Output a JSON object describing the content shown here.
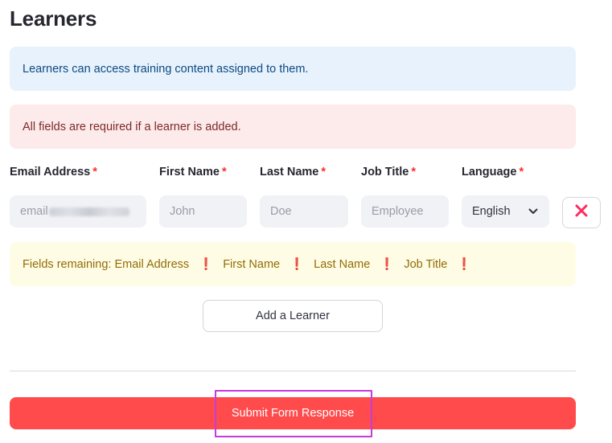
{
  "page": {
    "title": "Learners"
  },
  "alerts": {
    "info": "Learners can access training content assigned to them.",
    "error": "All fields are required if a learner is added."
  },
  "columns": {
    "email": "Email Address",
    "first_name": "First Name",
    "last_name": "Last Name",
    "job_title": "Job Title",
    "language": "Language",
    "required_marker": "*"
  },
  "row": {
    "email_value": "email",
    "first_name_placeholder": "John",
    "last_name_placeholder": "Doe",
    "job_title_placeholder": "Employee",
    "language_selected": "English"
  },
  "warning": {
    "prefix": "Fields remaining:",
    "fields": [
      "Email Address",
      "First Name",
      "Last Name",
      "Job Title"
    ],
    "marker": "❗"
  },
  "buttons": {
    "add_learner": "Add a Learner",
    "submit": "Submit Form Response"
  },
  "colors": {
    "primary": "#ff4b4b",
    "info_bg": "#e8f2fd",
    "error_bg": "#fdeaea",
    "warning_bg": "#fffce6",
    "focus_outline": "#c53cd8",
    "remove_icon": "#ff2b5e"
  },
  "icons": {
    "select": "chevron-down-icon",
    "remove": "close-icon"
  }
}
